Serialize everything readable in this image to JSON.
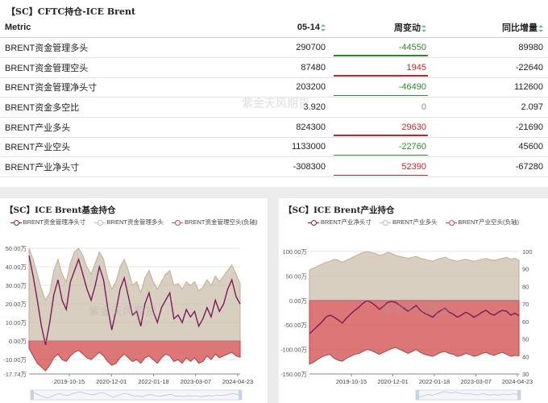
{
  "table": {
    "title": "【SC】CFTC持仓-ICE Brent",
    "headers": {
      "metric": "Metric",
      "date": "05-14",
      "weekly": "周变动",
      "yoy": "同比增量"
    },
    "rows": [
      {
        "metric": "BRENT资金管理多头",
        "date": "290700",
        "weekly": "-44550",
        "yoy": "89980",
        "sign": "neg"
      },
      {
        "metric": "BRENT资金管理空头",
        "date": "87480",
        "weekly": "1945",
        "yoy": "-22640",
        "sign": "pos"
      },
      {
        "metric": "BRENT资金管理净头寸",
        "date": "203200",
        "weekly": "-46490",
        "yoy": "112600",
        "sign": "neg"
      },
      {
        "metric": "BRENT资金多空比",
        "date": "3.920",
        "weekly": "0",
        "yoy": "2.097",
        "sign": "zero"
      },
      {
        "metric": "BRENT产业多头",
        "date": "824300",
        "weekly": "29630",
        "yoy": "-21690",
        "sign": "pos"
      },
      {
        "metric": "BRENT产业空头",
        "date": "1133000",
        "weekly": "-22760",
        "yoy": "45600",
        "sign": "neg"
      },
      {
        "metric": "BRENT产业净头寸",
        "date": "-308300",
        "weekly": "52390",
        "yoy": "-67280",
        "sign": "pos"
      }
    ]
  },
  "watermark": "紫金天风期货",
  "chart_data": [
    {
      "type": "area",
      "title": "【SC】ICE Brent基金持仓",
      "legend": [
        "BRENT资金管理净头寸",
        "BRENT资金管理多头",
        "BRENT资金管理空头(负轴)"
      ],
      "y_ticks": [
        "50.00万",
        "40.00万",
        "30.00万",
        "20.00万",
        "10.00万",
        "0.00万",
        "-10.00万",
        "-17.74万"
      ],
      "ylim": [
        -17.74,
        50
      ],
      "x_ticks": [
        "2019-10-15",
        "2020-12-01",
        "2022-01-18",
        "2023-03-07",
        "2024-04-23"
      ],
      "series": [
        {
          "name": "BRENT资金管理净头寸",
          "kind": "line",
          "color": "#7d1a5a",
          "values": [
            46,
            35,
            22,
            8,
            -2,
            10,
            25,
            33,
            22,
            17,
            32,
            38,
            44,
            36,
            28,
            22,
            30,
            40,
            33,
            18,
            6,
            16,
            28,
            34,
            24,
            14,
            16,
            8,
            20,
            26,
            16,
            10,
            18,
            22,
            26,
            12,
            14,
            10,
            17,
            13,
            16,
            8,
            12,
            18,
            13,
            22,
            16,
            20,
            28,
            33,
            24,
            20
          ]
        },
        {
          "name": "BRENT资金管理多头",
          "kind": "area",
          "color": "#c9bba6",
          "values": [
            50,
            44,
            36,
            28,
            22,
            26,
            38,
            44,
            36,
            32,
            42,
            48,
            50,
            46,
            40,
            36,
            42,
            48,
            44,
            34,
            28,
            32,
            40,
            44,
            38,
            30,
            32,
            26,
            34,
            38,
            32,
            28,
            32,
            36,
            38,
            30,
            31,
            28,
            32,
            30,
            32,
            27,
            29,
            33,
            30,
            35,
            32,
            35,
            38,
            41,
            36,
            31
          ]
        },
        {
          "name": "BRENT资金管理空头(负轴)",
          "kind": "area",
          "color": "#d24a4a",
          "values": [
            -4,
            -8,
            -12,
            -14,
            -16,
            -13,
            -9,
            -7,
            -10,
            -11,
            -8,
            -6,
            -5,
            -7,
            -9,
            -10,
            -8,
            -6,
            -8,
            -11,
            -13,
            -12,
            -9,
            -7,
            -9,
            -11,
            -10,
            -12,
            -9,
            -8,
            -10,
            -12,
            -9,
            -7,
            -8,
            -11,
            -10,
            -12,
            -9,
            -11,
            -9,
            -12,
            -11,
            -8,
            -10,
            -7,
            -9,
            -8,
            -7,
            -6,
            -8,
            -8.7
          ]
        }
      ]
    },
    {
      "type": "area",
      "title": "【SC】ICE Brent产业持仓",
      "legend": [
        "BRENT产业净头寸",
        "BRENT产业多头",
        "BRENT产业空头(负轴)"
      ],
      "y_ticks_left": [
        "100.00万",
        "50.00万",
        "0.00万",
        "-50.00万",
        "-100.00万",
        "-150.00万"
      ],
      "y_ticks_right": [
        "100",
        "90",
        "80",
        "70",
        "60",
        "50",
        "40",
        "30"
      ],
      "ylim": [
        -150,
        100
      ],
      "x_ticks": [
        "2019-10-15",
        "2020-12-01",
        "2022-01-18",
        "2023-03-07",
        "2024-04-23"
      ],
      "series": [
        {
          "name": "BRENT产业多头",
          "kind": "area",
          "color": "#c9bba6",
          "values": [
            62,
            66,
            70,
            74,
            78,
            80,
            84,
            82,
            78,
            82,
            86,
            90,
            94,
            98,
            100,
            98,
            96,
            92,
            94,
            98,
            96,
            92,
            90,
            88,
            86,
            88,
            90,
            86,
            84,
            82,
            80,
            84,
            86,
            88,
            84,
            82,
            80,
            82,
            84,
            82,
            80,
            82,
            84,
            86,
            83,
            82,
            84,
            86,
            88,
            84,
            86,
            82
          ]
        },
        {
          "name": "BRENT产业空头(负轴)",
          "kind": "area",
          "color": "#d24a4a",
          "values": [
            -130,
            -126,
            -120,
            -115,
            -112,
            -110,
            -118,
            -122,
            -124,
            -118,
            -114,
            -110,
            -108,
            -104,
            -100,
            -102,
            -106,
            -110,
            -106,
            -102,
            -98,
            -96,
            -100,
            -104,
            -108,
            -104,
            -100,
            -106,
            -110,
            -112,
            -114,
            -110,
            -106,
            -104,
            -108,
            -110,
            -114,
            -112,
            -108,
            -110,
            -114,
            -112,
            -108,
            -106,
            -110,
            -112,
            -108,
            -106,
            -110,
            -114,
            -112,
            -113
          ]
        },
        {
          "name": "BRENT产业净头寸",
          "kind": "line",
          "color": "#7d1a5a",
          "values": [
            -68,
            -60,
            -52,
            -44,
            -34,
            -30,
            -34,
            -40,
            -46,
            -36,
            -28,
            -20,
            -14,
            -6,
            0,
            -4,
            -10,
            -18,
            -12,
            -4,
            -2,
            -4,
            -10,
            -16,
            -22,
            -16,
            -10,
            -20,
            -26,
            -30,
            -34,
            -26,
            -20,
            -16,
            -24,
            -28,
            -34,
            -30,
            -24,
            -28,
            -34,
            -30,
            -24,
            -20,
            -27,
            -30,
            -24,
            -20,
            -22,
            -30,
            -26,
            -31
          ]
        }
      ]
    }
  ]
}
